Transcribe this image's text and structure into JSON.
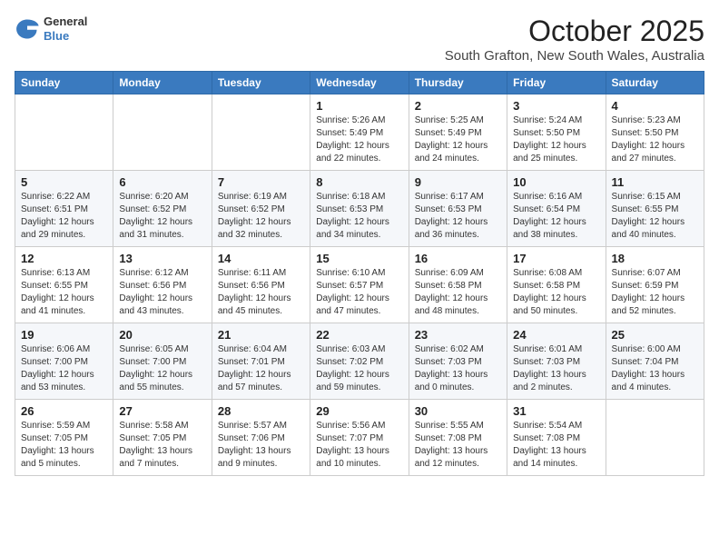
{
  "logo": {
    "general": "General",
    "blue": "Blue"
  },
  "header": {
    "month": "October 2025",
    "location": "South Grafton, New South Wales, Australia"
  },
  "weekdays": [
    "Sunday",
    "Monday",
    "Tuesday",
    "Wednesday",
    "Thursday",
    "Friday",
    "Saturday"
  ],
  "weeks": [
    [
      {
        "day": "",
        "info": ""
      },
      {
        "day": "",
        "info": ""
      },
      {
        "day": "",
        "info": ""
      },
      {
        "day": "1",
        "info": "Sunrise: 5:26 AM\nSunset: 5:49 PM\nDaylight: 12 hours\nand 22 minutes."
      },
      {
        "day": "2",
        "info": "Sunrise: 5:25 AM\nSunset: 5:49 PM\nDaylight: 12 hours\nand 24 minutes."
      },
      {
        "day": "3",
        "info": "Sunrise: 5:24 AM\nSunset: 5:50 PM\nDaylight: 12 hours\nand 25 minutes."
      },
      {
        "day": "4",
        "info": "Sunrise: 5:23 AM\nSunset: 5:50 PM\nDaylight: 12 hours\nand 27 minutes."
      }
    ],
    [
      {
        "day": "5",
        "info": "Sunrise: 6:22 AM\nSunset: 6:51 PM\nDaylight: 12 hours\nand 29 minutes."
      },
      {
        "day": "6",
        "info": "Sunrise: 6:20 AM\nSunset: 6:52 PM\nDaylight: 12 hours\nand 31 minutes."
      },
      {
        "day": "7",
        "info": "Sunrise: 6:19 AM\nSunset: 6:52 PM\nDaylight: 12 hours\nand 32 minutes."
      },
      {
        "day": "8",
        "info": "Sunrise: 6:18 AM\nSunset: 6:53 PM\nDaylight: 12 hours\nand 34 minutes."
      },
      {
        "day": "9",
        "info": "Sunrise: 6:17 AM\nSunset: 6:53 PM\nDaylight: 12 hours\nand 36 minutes."
      },
      {
        "day": "10",
        "info": "Sunrise: 6:16 AM\nSunset: 6:54 PM\nDaylight: 12 hours\nand 38 minutes."
      },
      {
        "day": "11",
        "info": "Sunrise: 6:15 AM\nSunset: 6:55 PM\nDaylight: 12 hours\nand 40 minutes."
      }
    ],
    [
      {
        "day": "12",
        "info": "Sunrise: 6:13 AM\nSunset: 6:55 PM\nDaylight: 12 hours\nand 41 minutes."
      },
      {
        "day": "13",
        "info": "Sunrise: 6:12 AM\nSunset: 6:56 PM\nDaylight: 12 hours\nand 43 minutes."
      },
      {
        "day": "14",
        "info": "Sunrise: 6:11 AM\nSunset: 6:56 PM\nDaylight: 12 hours\nand 45 minutes."
      },
      {
        "day": "15",
        "info": "Sunrise: 6:10 AM\nSunset: 6:57 PM\nDaylight: 12 hours\nand 47 minutes."
      },
      {
        "day": "16",
        "info": "Sunrise: 6:09 AM\nSunset: 6:58 PM\nDaylight: 12 hours\nand 48 minutes."
      },
      {
        "day": "17",
        "info": "Sunrise: 6:08 AM\nSunset: 6:58 PM\nDaylight: 12 hours\nand 50 minutes."
      },
      {
        "day": "18",
        "info": "Sunrise: 6:07 AM\nSunset: 6:59 PM\nDaylight: 12 hours\nand 52 minutes."
      }
    ],
    [
      {
        "day": "19",
        "info": "Sunrise: 6:06 AM\nSunset: 7:00 PM\nDaylight: 12 hours\nand 53 minutes."
      },
      {
        "day": "20",
        "info": "Sunrise: 6:05 AM\nSunset: 7:00 PM\nDaylight: 12 hours\nand 55 minutes."
      },
      {
        "day": "21",
        "info": "Sunrise: 6:04 AM\nSunset: 7:01 PM\nDaylight: 12 hours\nand 57 minutes."
      },
      {
        "day": "22",
        "info": "Sunrise: 6:03 AM\nSunset: 7:02 PM\nDaylight: 12 hours\nand 59 minutes."
      },
      {
        "day": "23",
        "info": "Sunrise: 6:02 AM\nSunset: 7:03 PM\nDaylight: 13 hours\nand 0 minutes."
      },
      {
        "day": "24",
        "info": "Sunrise: 6:01 AM\nSunset: 7:03 PM\nDaylight: 13 hours\nand 2 minutes."
      },
      {
        "day": "25",
        "info": "Sunrise: 6:00 AM\nSunset: 7:04 PM\nDaylight: 13 hours\nand 4 minutes."
      }
    ],
    [
      {
        "day": "26",
        "info": "Sunrise: 5:59 AM\nSunset: 7:05 PM\nDaylight: 13 hours\nand 5 minutes."
      },
      {
        "day": "27",
        "info": "Sunrise: 5:58 AM\nSunset: 7:05 PM\nDaylight: 13 hours\nand 7 minutes."
      },
      {
        "day": "28",
        "info": "Sunrise: 5:57 AM\nSunset: 7:06 PM\nDaylight: 13 hours\nand 9 minutes."
      },
      {
        "day": "29",
        "info": "Sunrise: 5:56 AM\nSunset: 7:07 PM\nDaylight: 13 hours\nand 10 minutes."
      },
      {
        "day": "30",
        "info": "Sunrise: 5:55 AM\nSunset: 7:08 PM\nDaylight: 13 hours\nand 12 minutes."
      },
      {
        "day": "31",
        "info": "Sunrise: 5:54 AM\nSunset: 7:08 PM\nDaylight: 13 hours\nand 14 minutes."
      },
      {
        "day": "",
        "info": ""
      }
    ]
  ]
}
